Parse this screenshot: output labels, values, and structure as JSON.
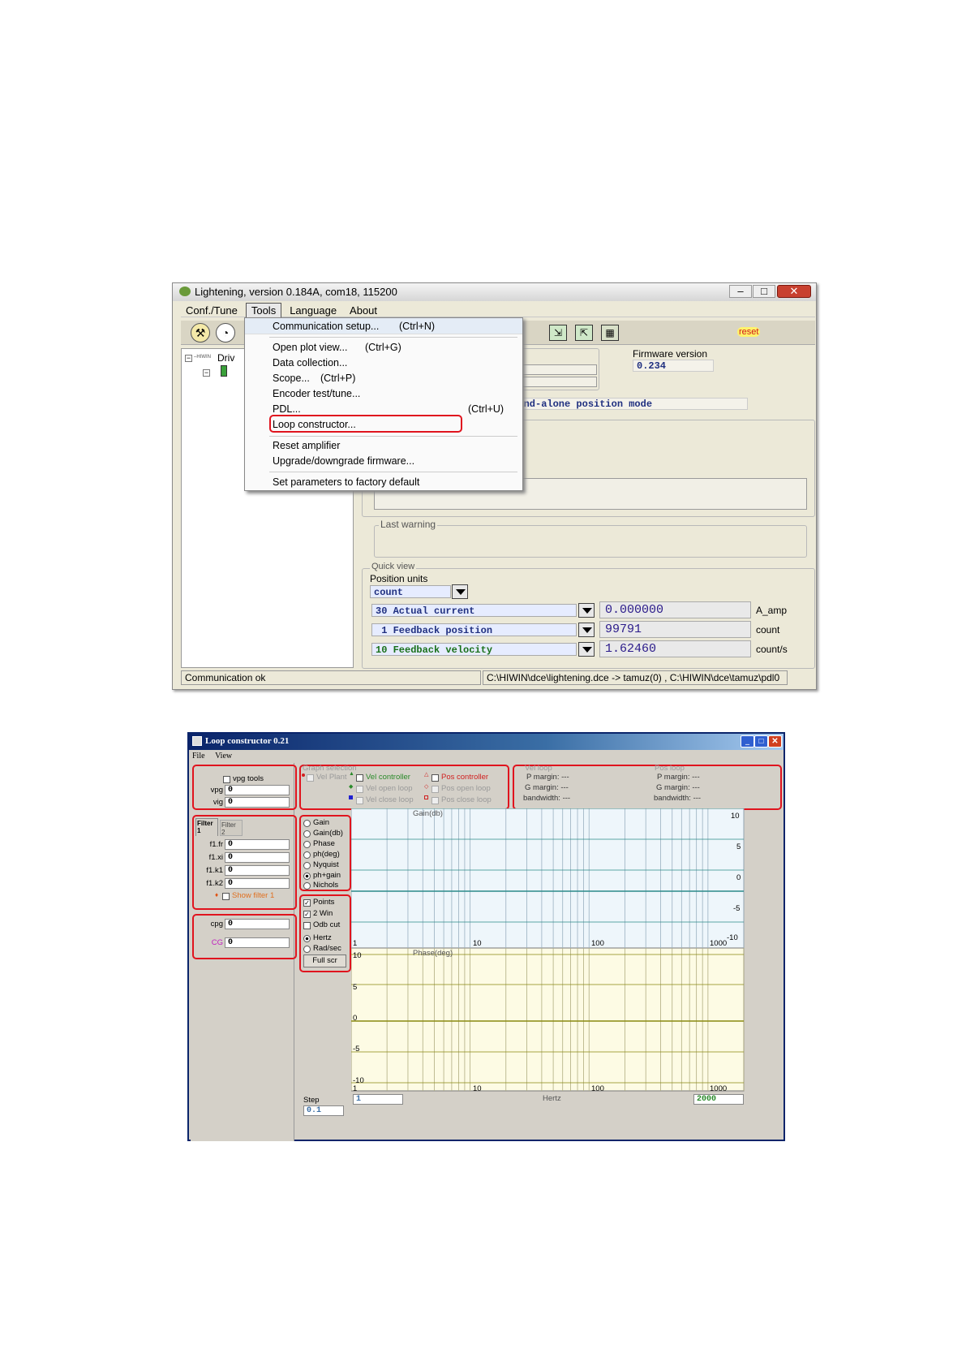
{
  "window1": {
    "title": "Lightening, version 0.184A, com18, 115200",
    "menu": [
      "Conf./Tune",
      "Tools",
      "Language",
      "About"
    ],
    "reset_label": "reset",
    "tree_label": "Driv",
    "tools_menu": {
      "items": [
        {
          "label": "Communication setup...",
          "shortcut": "(Ctrl+N)"
        },
        {
          "label": "Open plot view...",
          "shortcut": "(Ctrl+G)"
        },
        {
          "label": "Data collection...",
          "shortcut": ""
        },
        {
          "label": "Scope...",
          "shortcut": "(Ctrl+P)"
        },
        {
          "label": "Encoder test/tune...",
          "shortcut": ""
        },
        {
          "label": "PDL...",
          "shortcut": "(Ctrl+U)"
        },
        {
          "label": "Loop constructor...",
          "shortcut": ""
        },
        {
          "label": "Reset amplifier",
          "shortcut": ""
        },
        {
          "label": "Upgrade/downgrade firmware...",
          "shortcut": ""
        },
        {
          "label": "Set parameters to factory default",
          "shortcut": ""
        }
      ]
    },
    "firmware": {
      "label": "Firmware version",
      "value": "0.234"
    },
    "mode_text": "Stand-alone position mode",
    "last_warning_label": "Last warning",
    "quick_view": {
      "label": "Quick view",
      "position_units_label": "Position units",
      "position_units_value": "count",
      "rows": [
        {
          "variable": "30 Actual current",
          "value": "0.000000",
          "unit": "A_amp"
        },
        {
          "variable": " 1 Feedback position",
          "value": "99791",
          "unit": "count"
        },
        {
          "variable": "10 Feedback velocity",
          "value": "1.62460",
          "unit": "count/s"
        }
      ]
    },
    "status": {
      "left": "Communication ok",
      "right": "C:\\HIWIN\\dce\\lightening.dce -> tamuz(0) , C:\\HIWIN\\dce\\tamuz\\pdl0"
    }
  },
  "window2": {
    "title": "Loop constructor 0.21",
    "menu": [
      "File",
      "View"
    ],
    "vpg_tools_label": "vpg tools",
    "vpg": {
      "label": "vpg",
      "value": "0"
    },
    "vig": {
      "label": "vig",
      "value": "0"
    },
    "graph_selection": {
      "label": "Graph selection",
      "vel_plant": "Vel Plant",
      "vel_controller": "Vel controller",
      "pos_controller": "Pos controller",
      "vel_open_loop": "Vel open loop",
      "pos_open_loop": "Pos open loop",
      "vel_close_loop": "Vel close loop",
      "pos_close_loop": "Pos close loop"
    },
    "vel_loop": {
      "label": "Vel loop",
      "p_margin": "P margin: ---",
      "g_margin": "G margin: ---",
      "bandwidth": "bandwidth: ---"
    },
    "pos_loop": {
      "label": "Pos loop",
      "p_margin": "P margin: ---",
      "g_margin": "G margin: ---",
      "bandwidth": "bandwidth: ---"
    },
    "filter_tabs": [
      {
        "label": "Filter",
        "num": "1"
      },
      {
        "label": "Filter",
        "num": "2"
      }
    ],
    "filter_fields": [
      {
        "label": "f1.fr",
        "value": "0"
      },
      {
        "label": "f1.xi",
        "value": "0"
      },
      {
        "label": "f1.k1",
        "value": "0"
      },
      {
        "label": "f1.k2",
        "value": "0"
      }
    ],
    "show_filter": "Show filter 1",
    "cpg": {
      "label": "cpg",
      "value": "0"
    },
    "cg": {
      "label": "CG",
      "value": "0"
    },
    "plot_modes": [
      "Gain",
      "Gain(db)",
      "Phase",
      "ph(deg)",
      "Nyquist",
      "ph+gain",
      "Nichols"
    ],
    "options": [
      "Points",
      "2 Win",
      "Odb cut"
    ],
    "units": [
      "Hertz",
      "Rad/sec"
    ],
    "full_scr": "Full scr",
    "step": {
      "label": "Step",
      "value": "0.1"
    },
    "gain_plot": {
      "title": "Gain(db)",
      "y_ticks": [
        "10",
        "5",
        "0",
        "-5",
        "-10"
      ],
      "x_ticks": [
        "1",
        "10",
        "100",
        "1000"
      ]
    },
    "phase_plot": {
      "title": "Phase(deg)",
      "y_ticks": [
        "10",
        "5",
        "0",
        "-5",
        "-10"
      ],
      "x_ticks": [
        "1",
        "10",
        "100",
        "1000"
      ]
    },
    "x_min": "1",
    "x_label": "Hertz",
    "x_max": "2000"
  }
}
